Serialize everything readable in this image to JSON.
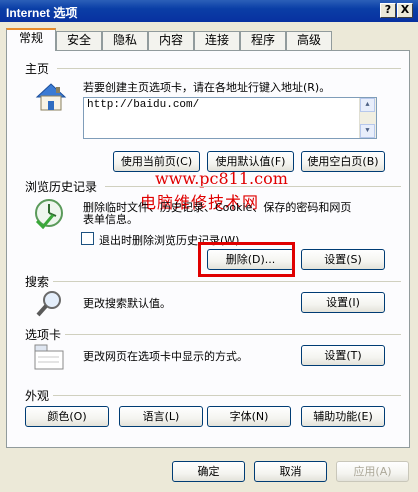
{
  "window": {
    "title": "Internet 选项",
    "help_button": "?",
    "close_button": "X"
  },
  "tabs": [
    "常规",
    "安全",
    "隐私",
    "内容",
    "连接",
    "程序",
    "高级"
  ],
  "home": {
    "group_label": "主页",
    "description": "若要创建主页选项卡，请在各地址行键入地址(R)。",
    "url": "http://baidu.com/",
    "btn_current": "使用当前页(C)",
    "btn_default": "使用默认值(F)",
    "btn_blank": "使用空白页(B)"
  },
  "history": {
    "group_label": "浏览历史记录",
    "description_line1": "删除临时文件、历史记录、Cookie、保存的密码和网页",
    "description_line2": "表单信息。",
    "checkbox_label": "退出时删除浏览历史记录(W)",
    "btn_delete": "删除(D)...",
    "btn_settings": "设置(S)"
  },
  "search": {
    "group_label": "搜索",
    "description": "更改搜索默认值。",
    "btn_settings": "设置(I)"
  },
  "tabs_group": {
    "group_label": "选项卡",
    "description": "更改网页在选项卡中显示的方式。",
    "btn_settings": "设置(T)"
  },
  "appearance": {
    "group_label": "外观",
    "btn_colors": "颜色(O)",
    "btn_languages": "语言(L)",
    "btn_fonts": "字体(N)",
    "btn_accessibility": "辅助功能(E)"
  },
  "footer": {
    "btn_ok": "确定",
    "btn_cancel": "取消",
    "btn_apply": "应用(A)"
  },
  "watermark": {
    "line1": "www.pc811.com",
    "line2": "电脑维修技术网"
  },
  "colors": {
    "title_bar": "#0a3ea6",
    "dialog_bg": "#ece9d8",
    "watermark": "#e00000",
    "highlight_box": "#e00000"
  }
}
